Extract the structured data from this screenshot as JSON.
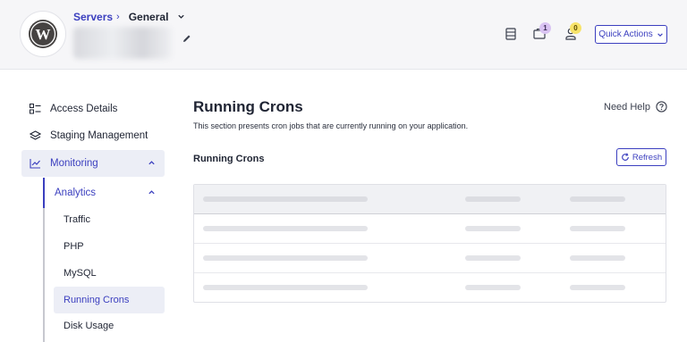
{
  "header": {
    "breadcrumb_root": "Servers",
    "breadcrumb_sep": "›",
    "breadcrumb_current": "General",
    "notifications_count": "1",
    "users_count": "0",
    "quick_actions_label": "Quick Actions"
  },
  "sidebar": {
    "items": [
      {
        "label": "Access Details"
      },
      {
        "label": "Staging Management"
      },
      {
        "label": "Monitoring"
      }
    ],
    "sub_group": {
      "label": "Analytics"
    },
    "sub_items": [
      {
        "label": "Traffic"
      },
      {
        "label": "PHP"
      },
      {
        "label": "MySQL"
      },
      {
        "label": "Running Crons"
      },
      {
        "label": "Disk Usage"
      }
    ]
  },
  "main": {
    "title": "Running Crons",
    "description": "This section presents cron jobs that are currently running on your application.",
    "help_label": "Need Help",
    "section_title": "Running Crons",
    "refresh_label": "Refresh"
  },
  "colors": {
    "accent": "#3b3fbf",
    "active_bg": "#eceef6",
    "badge_purple": "#d9c3f2",
    "badge_yellow": "#f7e36a"
  },
  "icons": {
    "logo": "wordpress-logo",
    "edit": "pencil-icon",
    "servers": "server-icon",
    "projects": "folder-icon",
    "users": "user-icon",
    "help": "question-circle-icon",
    "refresh": "refresh-icon"
  }
}
